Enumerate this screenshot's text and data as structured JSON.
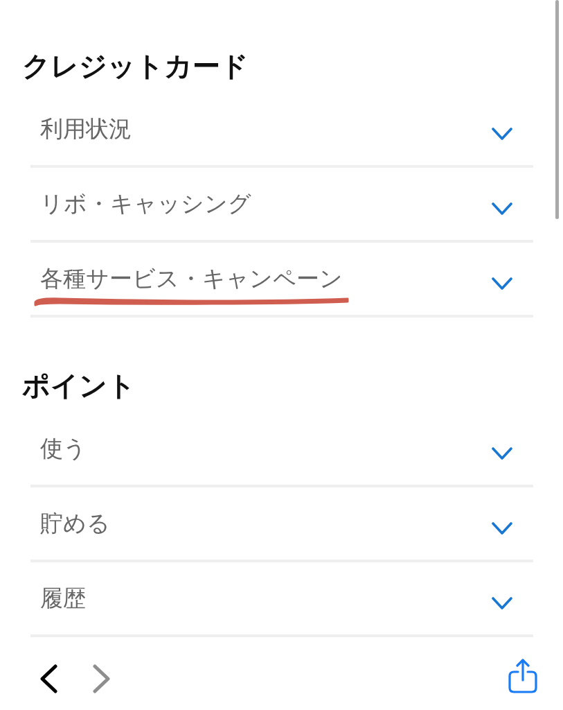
{
  "sections": [
    {
      "title": "クレジットカード",
      "items": [
        {
          "label": "利用状況",
          "expanded": false,
          "underlined": false
        },
        {
          "label": "リボ・キャッシング",
          "expanded": false,
          "underlined": false
        },
        {
          "label": "各種サービス・キャンペーン",
          "expanded": false,
          "underlined": true
        }
      ]
    },
    {
      "title": "ポイント",
      "items": [
        {
          "label": "使う",
          "expanded": false,
          "underlined": false
        },
        {
          "label": "貯める",
          "expanded": false,
          "underlined": false
        },
        {
          "label": "履歴",
          "expanded": false,
          "underlined": false
        }
      ]
    }
  ],
  "toolbar": [
    {
      "kind": "back",
      "disabled": false
    },
    {
      "kind": "forward",
      "disabled": true
    },
    {
      "kind": "share",
      "disabled": false
    }
  ]
}
